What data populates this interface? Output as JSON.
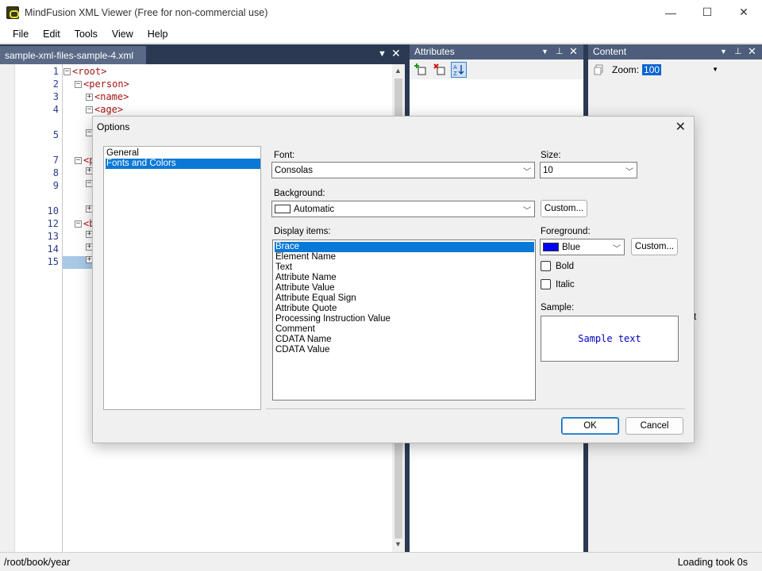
{
  "window": {
    "title": "MindFusion XML Viewer (Free for non-commercial use)",
    "minimize": "—",
    "maximize": "☐",
    "close": "✕"
  },
  "menu": {
    "file": "File",
    "edit": "Edit",
    "tools": "Tools",
    "view": "View",
    "help": "Help"
  },
  "editor": {
    "tab_label": "sample-xml-files-sample-4.xml",
    "line_numbers": [
      "1",
      "2",
      "3",
      "4",
      "5",
      "7",
      "8",
      "9",
      "10",
      "12",
      "13",
      "14",
      "15"
    ],
    "lines": [
      {
        "indent": 0,
        "expander": "−",
        "text": "<root>"
      },
      {
        "indent": 1,
        "expander": "−",
        "text": "<person>"
      },
      {
        "indent": 2,
        "expander": "+",
        "text": "<name>"
      },
      {
        "indent": 2,
        "expander": "−",
        "text": "<age>"
      }
    ],
    "partial_chars": [
      "<p",
      "<b"
    ]
  },
  "attributes": {
    "title": "Attributes"
  },
  "content": {
    "title": "Content",
    "zoom_label": "Zoom:",
    "zoom_value": "100",
    "partial_text": "t"
  },
  "status": {
    "path": "/root/book/year",
    "timing": "Loading took 0s"
  },
  "dialog": {
    "title": "Options",
    "categories": [
      "General",
      "Fonts and Colors"
    ],
    "selected_category": "Fonts and Colors",
    "font_label": "Font:",
    "font_value": "Consolas",
    "size_label": "Size:",
    "size_value": "10",
    "background_label": "Background:",
    "background_value": "Automatic",
    "background_swatch": "#ffffff",
    "custom_label": "Custom...",
    "display_items_label": "Display items:",
    "display_items": [
      "Brace",
      "Element Name",
      "Text",
      "Attribute Name",
      "Attribute Value",
      "Attribute Equal Sign",
      "Attribute Quote",
      "Processing Instruction Value",
      "Comment",
      "CDATA Name",
      "CDATA Value"
    ],
    "selected_item": "Brace",
    "foreground_label": "Foreground:",
    "foreground_value": "Blue",
    "foreground_swatch": "#0000ff",
    "bold_label": "Bold",
    "italic_label": "Italic",
    "bold_checked": false,
    "italic_checked": false,
    "sample_label": "Sample:",
    "sample_text": "Sample text",
    "ok_label": "OK",
    "cancel_label": "Cancel"
  }
}
